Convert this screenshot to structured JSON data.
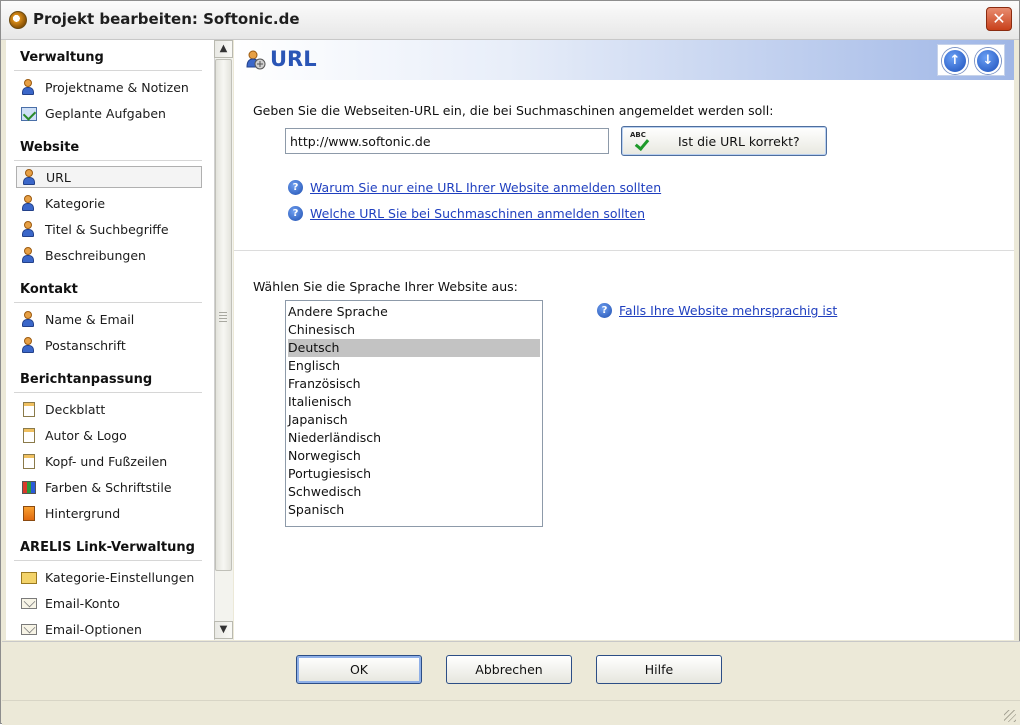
{
  "window": {
    "title": "Projekt bearbeiten: Softonic.de",
    "close_glyph": "✕"
  },
  "sidebar": {
    "sections": [
      {
        "title": "Verwaltung",
        "items": [
          {
            "label": "Projektname & Notizen",
            "icon": "person-icon"
          },
          {
            "label": "Geplante Aufgaben",
            "icon": "tasks-icon"
          }
        ]
      },
      {
        "title": "Website",
        "items": [
          {
            "label": "URL",
            "icon": "user-link-icon",
            "active": true
          },
          {
            "label": "Kategorie",
            "icon": "user-folder-icon"
          },
          {
            "label": "Titel & Suchbegriffe",
            "icon": "user-doc-icon"
          },
          {
            "label": "Beschreibungen",
            "icon": "user-doc-icon"
          }
        ]
      },
      {
        "title": "Kontakt",
        "items": [
          {
            "label": "Name & Email",
            "icon": "user-card-icon"
          },
          {
            "label": "Postanschrift",
            "icon": "user-address-icon"
          }
        ]
      },
      {
        "title": "Berichtanpassung",
        "items": [
          {
            "label": "Deckblatt",
            "icon": "document-icon"
          },
          {
            "label": "Autor & Logo",
            "icon": "document-icon"
          },
          {
            "label": "Kopf- und Fußzeilen",
            "icon": "document-icon"
          },
          {
            "label": "Farben & Schriftstile",
            "icon": "palette-icon"
          },
          {
            "label": "Hintergrund",
            "icon": "background-icon"
          }
        ]
      },
      {
        "title": "ARELIS Link-Verwaltung",
        "items": [
          {
            "label": "Kategorie-Einstellungen",
            "icon": "folder-icon"
          },
          {
            "label": "Email-Konto",
            "icon": "envelope-icon"
          },
          {
            "label": "Email-Optionen",
            "icon": "envelope-icon"
          }
        ]
      }
    ],
    "scroll_up": "▲",
    "scroll_down": "▼"
  },
  "main": {
    "title": "URL",
    "nav_up": "↑",
    "nav_down": "↓",
    "url_prompt": "Geben Sie die Webseiten-URL ein, die bei Suchmaschinen angemeldet werden soll:",
    "url_value": "http://www.softonic.de",
    "check_button": "Ist die URL korrekt?",
    "check_button_icon_text": "ABC",
    "help_links": [
      "Warum Sie nur eine URL Ihrer Website anmelden sollten",
      "Welche URL Sie bei Suchmaschinen anmelden sollten"
    ],
    "language_prompt": "Wählen Sie die Sprache Ihrer Website aus:",
    "languages": [
      "Andere Sprache",
      "Chinesisch",
      "Deutsch",
      "Englisch",
      "Französisch",
      "Italienisch",
      "Japanisch",
      "Niederländisch",
      "Norwegisch",
      "Portugiesisch",
      "Schwedisch",
      "Spanisch"
    ],
    "selected_language": "Deutsch",
    "multilingual_link": "Falls Ihre Website mehrsprachig ist",
    "help_glyph": "?"
  },
  "buttons": {
    "ok": "OK",
    "cancel": "Abbrechen",
    "help": "Hilfe"
  }
}
